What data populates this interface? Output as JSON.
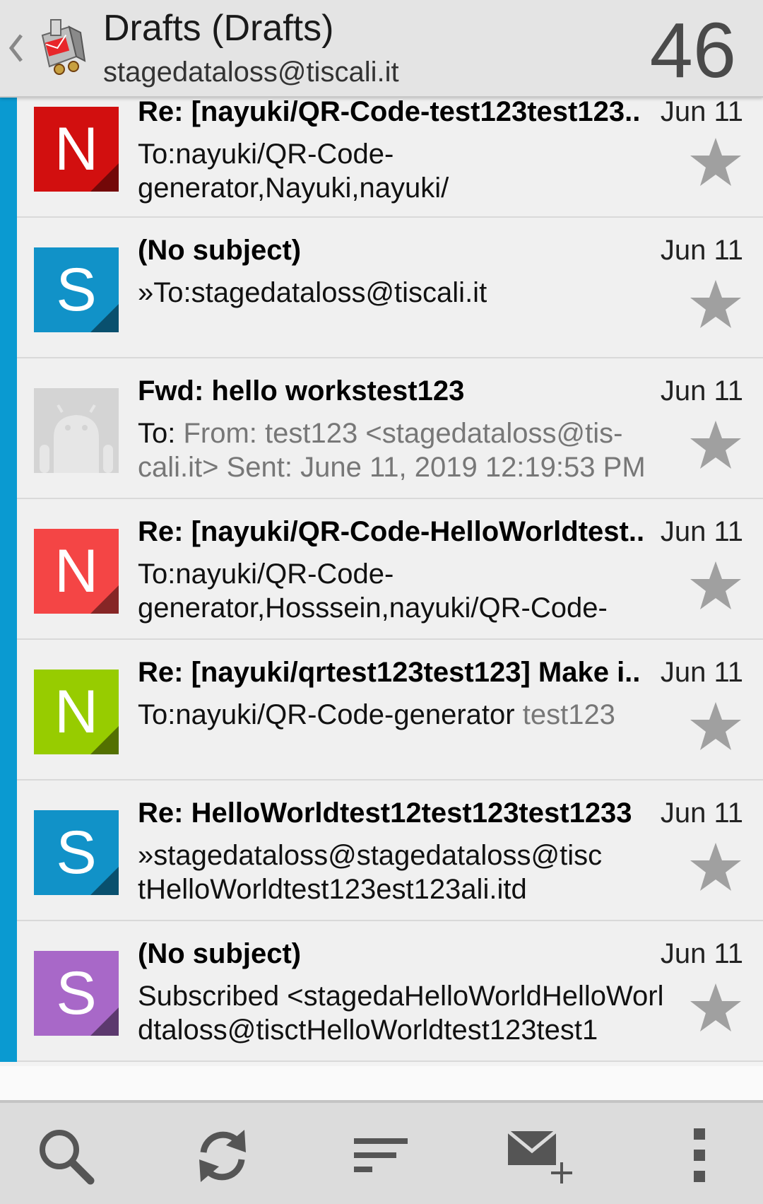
{
  "header": {
    "title": "Drafts (Drafts)",
    "account": "stagedataloss@tiscali.it",
    "count": "46"
  },
  "messages": [
    {
      "avatar_letter": "N",
      "avatar_color": "#d20f0f",
      "subject": "Re: [nayuki/QR-Code-test123test123..",
      "date": "Jun 11",
      "preview_main": "To:nayuki/QR-Code-generator,Nayuki,nayuki/",
      "preview_muted": ""
    },
    {
      "avatar_letter": "S",
      "avatar_color": "#1192c8",
      "subject": "(No subject)",
      "date": "Jun 11",
      "preview_main": "»To:stagedataloss@tiscali.it",
      "preview_muted": ""
    },
    {
      "avatar_letter": "",
      "avatar_color": "#d4d4d4",
      "subject": "Fwd: hello workstest123",
      "date": "Jun 11",
      "preview_main": "To: ",
      "preview_muted": "From: test123 <stagedataloss@tis-cali.it> Sent: June 11, 2019 12:19:53 PM"
    },
    {
      "avatar_letter": "N",
      "avatar_color": "#f44545",
      "subject": "Re: [nayuki/QR-Code-HelloWorldtest..",
      "date": "Jun 11",
      "preview_main": "To:nayuki/QR-Code-generator,Hosssein,nayuki/QR-Code-",
      "preview_muted": ""
    },
    {
      "avatar_letter": "N",
      "avatar_color": "#97cc00",
      "subject": "Re: [nayuki/qrtest123test123] Make i..",
      "date": "Jun 11",
      "preview_main": "To:nayuki/QR-Code-generator ",
      "preview_muted": "test123"
    },
    {
      "avatar_letter": "S",
      "avatar_color": "#1192c8",
      "subject": "Re: HelloWorldtest12test123test1233",
      "date": "Jun 11",
      "preview_main": "»stagedataloss@stagedataloss@tisctHelloWorldtest123est123ali.itd",
      "preview_muted": ""
    },
    {
      "avatar_letter": "S",
      "avatar_color": "#a868c8",
      "subject": "(No subject)",
      "date": "Jun 11",
      "preview_main": "Subscribed <stagedaHelloWorldHelloWorldtaloss@tisctHelloWorldtest123test1",
      "preview_muted": ""
    }
  ],
  "toolbar": {
    "icons": [
      "search-icon",
      "refresh-icon",
      "sort-icon",
      "compose-icon",
      "overflow-menu-icon"
    ]
  },
  "colors": {
    "unread_bar": "#0a9ad1",
    "star": "#a0a0a0"
  }
}
